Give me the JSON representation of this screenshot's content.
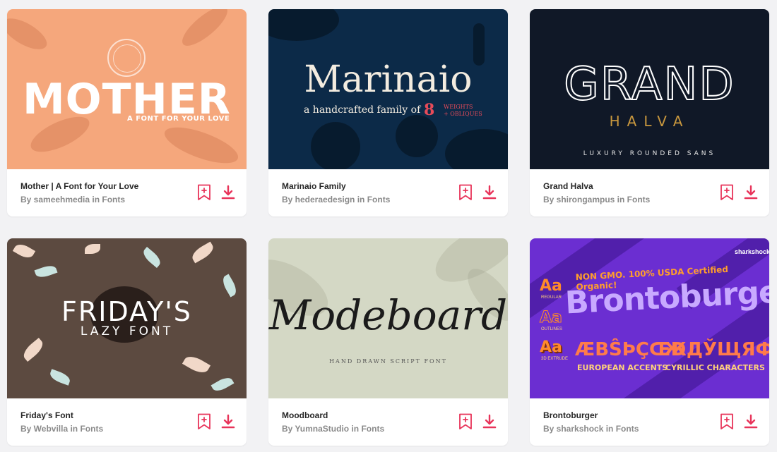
{
  "cards": [
    {
      "title": "Mother | A Font for Your Love",
      "byline": "By sameehmedia in Fonts",
      "thumb": {
        "headline": "MOTHER",
        "sub": "A FONT FOR YOUR LOVE"
      }
    },
    {
      "title": "Marinaio Family",
      "byline": "By hederaedesign in Fonts",
      "thumb": {
        "headline": "Marinaio",
        "sub": "a handcrafted family of",
        "number": "8",
        "weights": "WEIGHTS",
        "obliques": "+ OBLIQUES"
      }
    },
    {
      "title": "Grand Halva",
      "byline": "By shirongampus in Fonts",
      "thumb": {
        "headline": "GRAND",
        "mid": "HALVA",
        "sub": "LUXURY ROUNDED SANS"
      }
    },
    {
      "title": "Friday's Font",
      "byline": "By Webvilla in Fonts",
      "thumb": {
        "headline": "FRIDAY'S",
        "sub": "LAZY FONT"
      }
    },
    {
      "title": "Moodboard",
      "byline": "By YumnaStudio in Fonts",
      "thumb": {
        "headline": "Modeboard",
        "sub": "HAND DRAWN SCRIPT FONT"
      }
    },
    {
      "title": "Brontoburger",
      "byline": "By sharkshock in Fonts",
      "thumb": {
        "logo": "sharkshock",
        "top": "NON GMO. 100% USDA Certified Organic!",
        "headline": "Brontoburger",
        "aa": "Aa",
        "regular": "REGULAR",
        "outlines": "OUTLINES",
        "extrude": "3D EXTRUDE",
        "european": "ÆBŜÞÇŒÐ",
        "european_label": "EUROPEAN ACCENTS",
        "cyrillic": "ЖДЎЩЯФЗ",
        "cyrillic_label": "CYRILLIC CHARACTERS"
      }
    }
  ],
  "icons": {
    "bookmark": "bookmark-add-icon",
    "download": "download-icon"
  },
  "colors": {
    "accent": "#e8345a",
    "title": "#262626",
    "meta": "#8a8a8a"
  }
}
